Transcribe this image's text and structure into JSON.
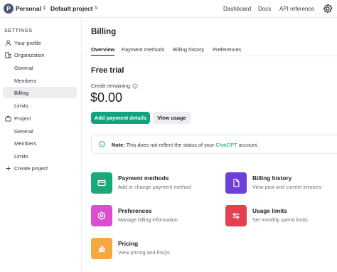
{
  "topbar": {
    "avatar_letter": "P",
    "org": "Personal",
    "separator": "/",
    "project": "Default project",
    "links": [
      "Dashboard",
      "Docs",
      "API reference"
    ]
  },
  "sidebar": {
    "heading": "SETTINGS",
    "items": [
      {
        "label": "Your profile",
        "icon": "person-icon"
      },
      {
        "label": "Organization",
        "icon": "building-icon"
      },
      {
        "label": "General"
      },
      {
        "label": "Members"
      },
      {
        "label": "Billing",
        "active": true
      },
      {
        "label": "Limits"
      },
      {
        "label": "Project",
        "icon": "briefcase-icon"
      },
      {
        "label": "General"
      },
      {
        "label": "Members"
      },
      {
        "label": "Limits"
      },
      {
        "label": "Create project",
        "icon": "plus-icon"
      }
    ]
  },
  "main": {
    "title": "Billing",
    "tabs": [
      "Overview",
      "Payment methods",
      "Billing history",
      "Preferences"
    ],
    "active_tab": "Overview",
    "section_title": "Free trial",
    "credit_label": "Credit remaining",
    "credit_value": "$0.00",
    "buttons": {
      "add_payment": "Add payment details",
      "view_usage": "View usage"
    },
    "notice": {
      "bold": "Note:",
      "text_before": "This does not reflect the status of your",
      "link": "ChatGPT",
      "text_after": "account."
    },
    "cards": [
      {
        "title": "Payment methods",
        "subtitle": "Add or change payment method",
        "color": "#19a97b",
        "icon": "credit-card-icon"
      },
      {
        "title": "Billing history",
        "subtitle": "View past and current invoices",
        "color": "#6e3fd8",
        "icon": "document-icon"
      },
      {
        "title": "Preferences",
        "subtitle": "Manage billing information",
        "color": "#d94fd0",
        "icon": "settings-icon"
      },
      {
        "title": "Usage limits",
        "subtitle": "Set monthly spend limits",
        "color": "#e5404f",
        "icon": "sliders-icon"
      },
      {
        "title": "Pricing",
        "subtitle": "View pricing and FAQs",
        "color": "#f5a742",
        "icon": "chart-icon"
      }
    ]
  },
  "colors": {
    "accent": "#10a37f",
    "sidebar_active": "#ececf1"
  }
}
